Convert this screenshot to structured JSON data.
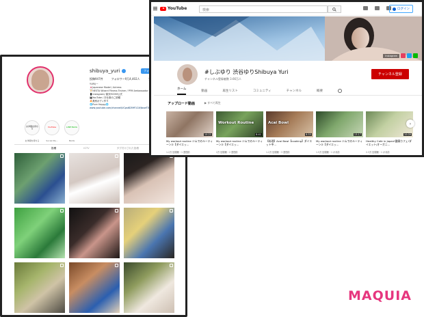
{
  "instagram": {
    "username": "shibuya_yuri",
    "follow_label": "フォローする",
    "stats": [
      "投稿947件",
      "フォロワー9万4,402人",
      "フォロー中95人"
    ],
    "bio": [
      "YURI(ー",
      "🇯🇵Japanese Model / Actress",
      "🏋️NESTA Wizard Fitness Trainer / PFM Ambassador",
      "📱Instagram/ 楽天ROOM公式",
      "🎬YouTube / お仕事のご依頼",
      "🔥美尻ボディ作り",
      "🌐Pure Happy🌐"
    ],
    "bio_link": "www.youtube.com/channel/UCps6D59F1C4fJbvwT0KK5b9g",
    "highlights": [
      {
        "inner": "お洋服を持ちる",
        "caption": "お洋服を持ちる"
      },
      {
        "inner": "YouTube",
        "caption": "Social Me..."
      },
      {
        "inner": "LINE BLOG",
        "caption": "BLOG"
      }
    ],
    "tabs": [
      "投稿",
      "IGTV",
      "タグ付けされた投稿"
    ],
    "grid": [
      {
        "bg": "linear-gradient(135deg,#2e5f3a 0%,#6da070 40%,#2b4f90 70%,#8ab0d0 100%)"
      },
      {
        "bg": "linear-gradient(160deg,#e7e2df 0%,#d4c8c2 45%,#fff 60%,#cbbdb5 100%)"
      },
      {
        "bg": "linear-gradient(150deg,#1a1a1a 0%,#2b2321 30%,#d9c2b5 55%,#f2e6df 100%)"
      },
      {
        "bg": "linear-gradient(135deg,#3ea040 0%,#7fd17a 40%,#2b7a3a 70%,#b6e3b0 100%)"
      },
      {
        "bg": "linear-gradient(135deg,#111 0%,#3a2c2a 40%,#c9958a 60%,#1d1716 100%)"
      },
      {
        "bg": "linear-gradient(135deg,#b8ad7a 0%,#e5d07a 35%,#4a75b0 65%,#2a2622 100%)"
      },
      {
        "bg": "linear-gradient(140deg,#6a7a3a 0%,#a6b56c 35%,#cfc3a6 60%,#4d4a43 100%)"
      },
      {
        "bg": "linear-gradient(140deg,#7a4a2a 0%,#c88d62 35%,#2b5fb0 70%,#e5d2b8 100%)"
      },
      {
        "bg": "linear-gradient(140deg,#3a4a2c 0%,#8f9c5e 35%,#efe8df 65%,#cdbfb2 100%)"
      }
    ]
  },
  "youtube": {
    "logo_text": "YouTube",
    "search_placeholder": "検索",
    "login_label": "ログイン",
    "banner_name": "Instagram",
    "channel_title": "#しぶゆり 渋谷ゆりShibuya Yuri",
    "subscribers": "チャンネル登録者数 3.66万人",
    "subscribe_label": "チャンネル登録",
    "tabs": [
      "ホーム",
      "動画",
      "再生リスト",
      "コミュニティ",
      "チャンネル",
      "概要"
    ],
    "section_title": "アップロード動画",
    "play_all": "▶ すべて再生",
    "videos": [
      {
        "overlay": "",
        "duration": "10:21",
        "title": "My workout routine ジムでのルーティーン②【ダイエッ...",
        "meta": "1.2万 回視聴・1 週間前",
        "bg": "linear-gradient(135deg,#c9b3a4 0%,#8f7563 45%,#e4d6cc 100%)"
      },
      {
        "overlay": "Workout Routine",
        "duration": "8:41",
        "title": "My workout routine ジムでのルーティーン②【ダイエッ...",
        "meta": "2万 回視聴・2 週間前",
        "bg": "linear-gradient(135deg,#3d5a33 0%,#78a35c 45%,#2c3e24 100%)"
      },
      {
        "overlay": "Acai Bowl",
        "duration": "8:55",
        "title": "【料理】Acai Bowl【cooking】ダイエット中...",
        "meta": "1.2万 回視聴・3 週間前",
        "bg": "linear-gradient(135deg,#5a3a2c 0%,#a47a56 45%,#d8c2a8 100%)"
      },
      {
        "overlay": "",
        "duration": "13:17",
        "title": "My workout routine ジムでのルーティーン②【ダイエッ...",
        "meta": "1.5万 回視聴・1 か月前",
        "bg": "linear-gradient(135deg,#2e4b2a 0%,#7fa76c 45%,#c6d6b6 100%)"
      },
      {
        "overlay": "",
        "duration": "10:09",
        "title": "Healthy Cafe in Japan!健康カフェ!ダイエット/オーガニ...",
        "meta": "2.3万 回視聴・1 か月前",
        "bg": "linear-gradient(135deg,#6d8a58 0%,#c2d0a2 45%,#f0e8d8 100%)"
      }
    ]
  },
  "brand": "MAQUIA"
}
